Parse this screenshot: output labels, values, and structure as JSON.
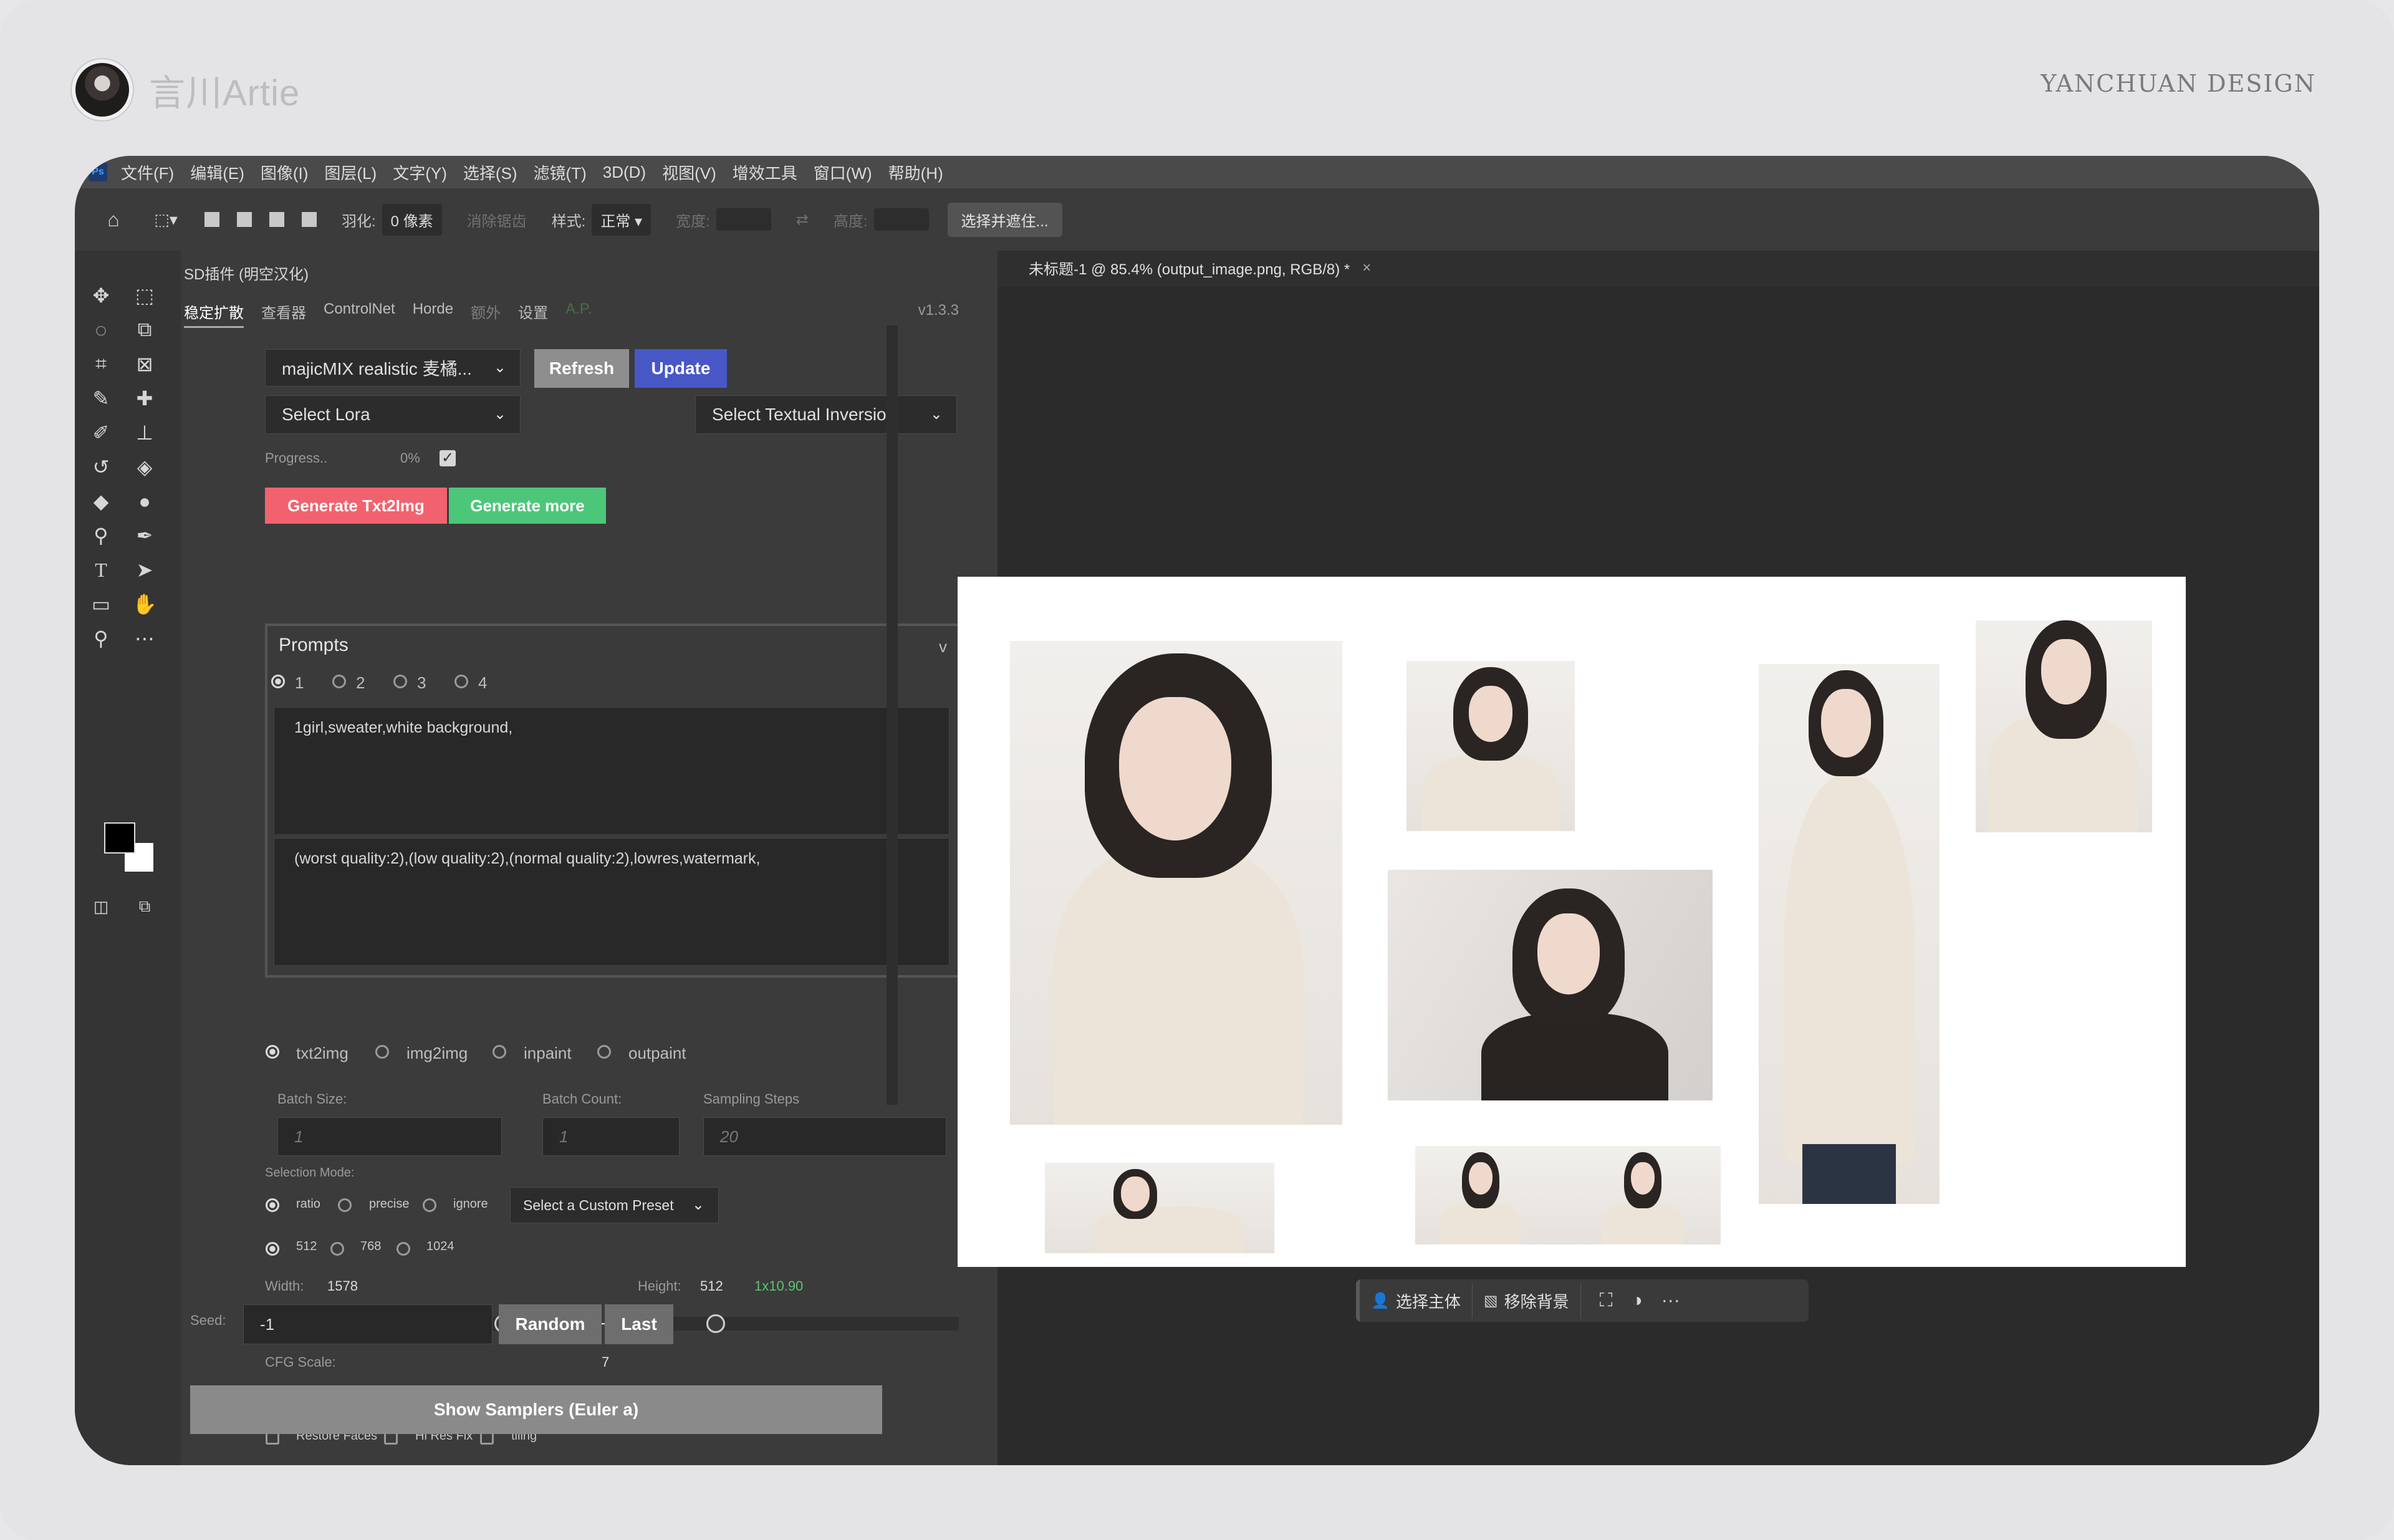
{
  "brand": {
    "name": "言川Artie",
    "tag": "YANCHUAN DESIGN"
  },
  "menubar": {
    "logo": "Ps",
    "items": [
      "文件(F)",
      "编辑(E)",
      "图像(I)",
      "图层(L)",
      "文字(Y)",
      "选择(S)",
      "滤镜(T)",
      "3D(D)",
      "视图(V)",
      "增效工具",
      "窗口(W)",
      "帮助(H)"
    ]
  },
  "options": {
    "feather_label": "羽化:",
    "feather_value": "0 像素",
    "antialias": "消除锯齿",
    "style_label": "样式:",
    "style_value": "正常",
    "width_label": "宽度:",
    "height_label": "高度:",
    "select_mask": "选择并遮住..."
  },
  "panel": {
    "title": "SD插件 (明空汉化)",
    "tabs": [
      "稳定扩散",
      "查看器",
      "ControlNet",
      "Horde",
      "额外",
      "设置",
      "A.P."
    ],
    "version": "v1.3.3",
    "model": "majicMIX realistic 麦橘...",
    "refresh": "Refresh",
    "update": "Update",
    "lora": "Select Lora",
    "textual_inversion": "Select Textual Inversion",
    "progress_label": "Progress..",
    "progress_value": "0%",
    "generate": "Generate Txt2Img",
    "generate_more": "Generate more",
    "prompts_title": "Prompts",
    "prompts_chevron": "v",
    "prompt_options": [
      "1",
      "2",
      "3",
      "4"
    ],
    "positive_prompt": "1girl,sweater,white background,",
    "negative_prompt": "(worst quality:2),(low quality:2),(normal quality:2),lowres,watermark,",
    "modes": [
      "txt2img",
      "img2img",
      "inpaint",
      "outpaint"
    ],
    "batch_size_label": "Batch Size:",
    "batch_size": "1",
    "batch_count_label": "Batch Count:",
    "batch_count": "1",
    "steps_label": "Sampling Steps",
    "steps": "20",
    "selection_mode_label": "Selection Mode:",
    "selection_modes": [
      "ratio",
      "precise",
      "ignore"
    ],
    "custom_preset": "Select a Custom Preset",
    "sizes": [
      "512",
      "768",
      "1024"
    ],
    "width_label": "Width:",
    "width_value": "1578",
    "height_label": "Height:",
    "height_value": "512",
    "ratio_value": "1x10.90",
    "cfg_label": "CFG Scale:",
    "cfg_value": "7",
    "checkboxes": [
      "Restore Faces",
      "Hi Res Fix",
      "tiling"
    ],
    "seed_label": "Seed:",
    "seed_value": "-1",
    "random": "Random",
    "last": "Last",
    "show_samplers": "Show Samplers (Euler a)"
  },
  "document": {
    "tab_title": "未标题-1 @ 85.4% (output_image.png, RGB/8) *",
    "close": "×"
  },
  "taskbar": {
    "select_subject": "选择主体",
    "remove_background": "移除背景",
    "more": "···"
  },
  "colors": {
    "generate_red": "#f2626e",
    "generate_green": "#4cc77a",
    "update_blue": "#4857c6",
    "refresh_gray": "#8e8e8e"
  }
}
